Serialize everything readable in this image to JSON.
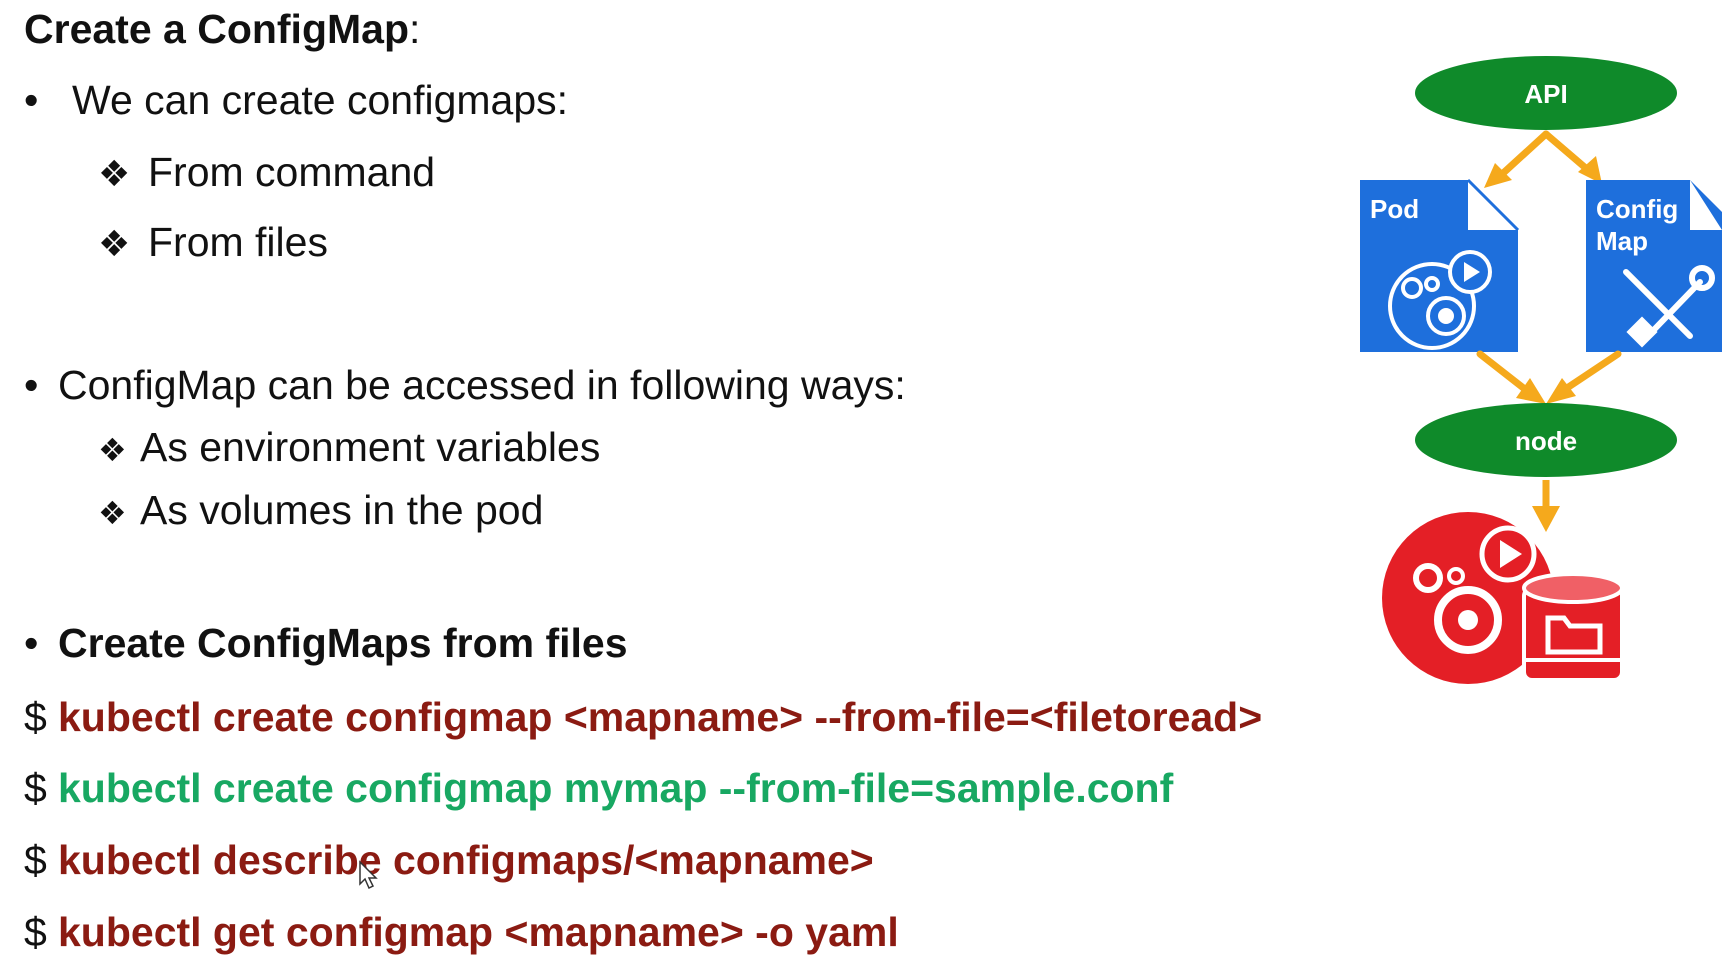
{
  "slide": {
    "title": "Create a ConfigMap",
    "title_suffix": ":",
    "bullet1": {
      "text": "We can create configmaps:",
      "items": [
        "From command",
        "From files"
      ]
    },
    "bullet2": {
      "text": "ConfigMap can be accessed in following ways:",
      "items": [
        "As environment variables",
        "As volumes in the pod"
      ]
    },
    "bullet3": {
      "text": "Create ConfigMaps from files"
    },
    "prompt": "$",
    "commands": [
      "kubectl create configmap <mapname> --from-file=<filetoread>",
      "kubectl create configmap mymap --from-file=sample.conf",
      "kubectl describe configmaps/<mapname>",
      "kubectl get configmap <mapname> -o yaml"
    ]
  },
  "diagram": {
    "api_label": "API",
    "pod_label": "Pod",
    "configmap_label_line1": "Config",
    "configmap_label_line2": "Map",
    "node_label": "node"
  },
  "colors": {
    "command_dark_red": "#8b1b12",
    "command_green": "#18a862",
    "ellipse_green": "#0f8a2a",
    "doc_blue": "#1e6fdc",
    "arrow_orange": "#f5a91c",
    "bottom_icon_red": "#e41f26"
  },
  "icons": [
    "bullet-dot",
    "diamond-bullet",
    "gears-play-icon",
    "tools-icon",
    "gears-database-icon",
    "mouse-cursor-icon"
  ]
}
